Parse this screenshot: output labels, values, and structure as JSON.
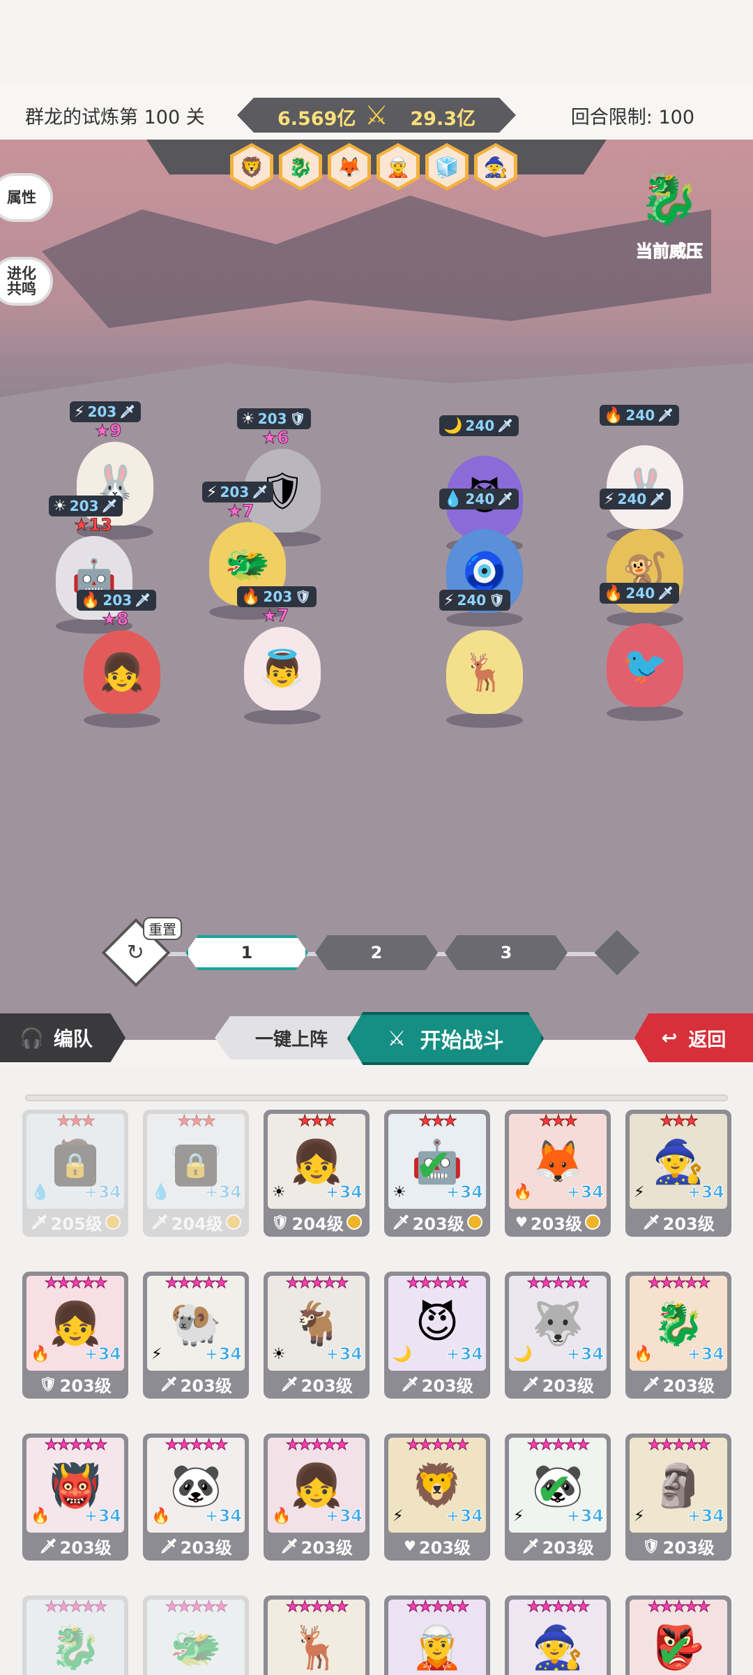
{
  "header": {
    "stage_name": "群龙的试炼第 100 关",
    "power_left": "6.569亿",
    "power_right": "29.3亿",
    "round_limit": "回合限制: 100"
  },
  "side_buttons": {
    "attributes": "属性",
    "evolution": "进化\n共鸣"
  },
  "pressure_label": "当前威压",
  "enemy_team_icons": [
    "🦁",
    "🐉",
    "🦊",
    "🧝",
    "🧊",
    "🧙"
  ],
  "player_units": [
    {
      "element": "⚡",
      "level": "203",
      "class": "🗡",
      "stars": "★9",
      "star_color": "pink",
      "avatar": "🐰"
    },
    {
      "element": "☀",
      "level": "203",
      "class": "🛡",
      "stars": "★6",
      "star_color": "pink",
      "avatar": "🛡"
    },
    {
      "element": "☀",
      "level": "203",
      "class": "🗡",
      "stars": "★13",
      "star_color": "red",
      "avatar": "🤖"
    },
    {
      "element": "⚡",
      "level": "203",
      "class": "🗡",
      "stars": "★7",
      "star_color": "pink",
      "avatar": "🐲"
    },
    {
      "element": "🔥",
      "level": "203",
      "class": "🗡",
      "stars": "★8",
      "star_color": "pink",
      "avatar": "👧"
    },
    {
      "element": "🔥",
      "level": "203",
      "class": "🛡",
      "stars": "★7",
      "star_color": "pink",
      "avatar": "👼"
    }
  ],
  "enemy_units": [
    {
      "element": "🌙",
      "level": "240",
      "class": "🗡",
      "avatar": "😈"
    },
    {
      "element": "🔥",
      "level": "240",
      "class": "🗡",
      "avatar": "🐰"
    },
    {
      "element": "💧",
      "level": "240",
      "class": "🗡",
      "avatar": "🧿"
    },
    {
      "element": "⚡",
      "level": "240",
      "class": "🗡",
      "avatar": "🐒"
    },
    {
      "element": "⚡",
      "level": "240",
      "class": "🛡",
      "avatar": "🦌"
    },
    {
      "element": "🔥",
      "level": "240",
      "class": "🗡",
      "avatar": "🐦"
    }
  ],
  "team_tabs": {
    "reset": "重置",
    "tab1": "1",
    "tab2": "2",
    "tab3": "3"
  },
  "actions": {
    "formation": "编队",
    "auto_deploy": "一键上阵",
    "start_battle": "开始战斗",
    "back": "返回"
  },
  "heroes": [
    {
      "stars": "★★★",
      "star_color": "red",
      "plus": "+34",
      "elem": "💧",
      "cls": "🗡",
      "level": "205级",
      "coin": true,
      "faded": true,
      "locked_overlay": true,
      "avatar": "🧔",
      "bar": "#b9b8bd"
    },
    {
      "stars": "★★★",
      "star_color": "red",
      "plus": "+34",
      "elem": "💧",
      "cls": "🗡",
      "level": "204级",
      "coin": true,
      "faded": true,
      "locked_overlay": true,
      "avatar": "🐻‍❄️",
      "bar": "#b9b8bd"
    },
    {
      "stars": "★★★",
      "star_color": "red",
      "plus": "+34",
      "elem": "☀",
      "cls": "🛡",
      "level": "204级",
      "coin": true,
      "avatar": "👧",
      "bar": "#8d8c92"
    },
    {
      "stars": "★★★",
      "star_color": "red",
      "plus": "+34",
      "elem": "☀",
      "cls": "🗡",
      "level": "203级",
      "coin": true,
      "checked": true,
      "avatar": "🤖",
      "bar": "#8d8c92"
    },
    {
      "stars": "★★★",
      "star_color": "red",
      "plus": "+34",
      "elem": "🔥",
      "cls": "♥",
      "level": "203级",
      "coin": true,
      "avatar": "🦊",
      "bar": "#8d8c92"
    },
    {
      "stars": "★★★",
      "star_color": "red",
      "plus": "+34",
      "elem": "⚡",
      "cls": "🗡",
      "level": "203级",
      "coin": false,
      "avatar": "🧙",
      "bar": "#8d8c92"
    },
    {
      "stars": "★★★★★",
      "star_color": "pink",
      "plus": "+34",
      "elem": "🔥",
      "cls": "🛡",
      "level": "203级",
      "avatar": "👧",
      "bar": "#8d8c92"
    },
    {
      "stars": "★★★★★",
      "star_color": "pink",
      "plus": "+34",
      "elem": "⚡",
      "cls": "🗡",
      "level": "203级",
      "avatar": "🐏",
      "bar": "#8d8c92"
    },
    {
      "stars": "★★★★★",
      "star_color": "pink",
      "plus": "+34",
      "elem": "☀",
      "cls": "🗡",
      "level": "203级",
      "avatar": "🐐",
      "bar": "#8d8c92"
    },
    {
      "stars": "★★★★★",
      "star_color": "pink",
      "plus": "+34",
      "elem": "🌙",
      "cls": "🗡",
      "level": "203级",
      "avatar": "😈",
      "bar": "#8d8c92"
    },
    {
      "stars": "★★★★★",
      "star_color": "pink",
      "plus": "+34",
      "elem": "🌙",
      "cls": "🗡",
      "level": "203级",
      "avatar": "🐺",
      "bar": "#8d8c92"
    },
    {
      "stars": "★★★★★",
      "star_color": "pink",
      "plus": "+34",
      "elem": "🔥",
      "cls": "🗡",
      "level": "203级",
      "avatar": "🐉",
      "bar": "#8d8c92"
    },
    {
      "stars": "★★★★★",
      "star_color": "pink",
      "plus": "+34",
      "elem": "🔥",
      "cls": "🗡",
      "level": "203级",
      "avatar": "👹",
      "bar": "#8d8c92"
    },
    {
      "stars": "★★★★★",
      "star_color": "pink",
      "plus": "+34",
      "elem": "🔥",
      "cls": "🗡",
      "level": "203级",
      "avatar": "🐼",
      "bar": "#8d8c92"
    },
    {
      "stars": "★★★★★",
      "star_color": "pink",
      "plus": "+34",
      "elem": "🔥",
      "cls": "🗡",
      "level": "203级",
      "avatar": "👧",
      "bar": "#8d8c92"
    },
    {
      "stars": "★★★★★",
      "star_color": "pink",
      "plus": "+34",
      "elem": "⚡",
      "cls": "♥",
      "level": "203级",
      "avatar": "🦁",
      "bar": "#8d8c92"
    },
    {
      "stars": "★★★★★",
      "star_color": "pink",
      "plus": "+34",
      "elem": "⚡",
      "cls": "🗡",
      "level": "203级",
      "checked": true,
      "avatar": "🐼",
      "bar": "#8d8c92"
    },
    {
      "stars": "★★★★★",
      "star_color": "pink",
      "plus": "+34",
      "elem": "⚡",
      "cls": "🛡",
      "level": "203级",
      "avatar": "🗿",
      "bar": "#8d8c92"
    },
    {
      "stars": "★★★★★",
      "star_color": "pink",
      "plus": "",
      "elem": "",
      "cls": "",
      "level": "",
      "faded": true,
      "avatar": "🐉",
      "bar": "#b9b8bd"
    },
    {
      "stars": "★★★★★",
      "star_color": "pink",
      "plus": "",
      "elem": "",
      "cls": "",
      "level": "",
      "faded": true,
      "avatar": "🐲",
      "bar": "#b9b8bd"
    },
    {
      "stars": "★★★★★",
      "star_color": "pink",
      "plus": "",
      "elem": "",
      "cls": "",
      "level": "",
      "avatar": "🦌",
      "bar": "#8d8c92"
    },
    {
      "stars": "★★★★★",
      "star_color": "pink",
      "plus": "",
      "elem": "",
      "cls": "",
      "level": "",
      "avatar": "🧝",
      "bar": "#8d8c92"
    },
    {
      "stars": "★★★★★",
      "star_color": "pink",
      "plus": "",
      "elem": "",
      "cls": "",
      "level": "",
      "avatar": "🧙",
      "bar": "#8d8c92"
    },
    {
      "stars": "★★★★★",
      "star_color": "pink",
      "plus": "",
      "elem": "",
      "cls": "",
      "level": "",
      "checked": true,
      "avatar": "👺",
      "bar": "#8d8c92"
    }
  ],
  "colors": {
    "accent_teal": "#158e83",
    "back_red": "#d7303a",
    "gold": "#ffe07a"
  }
}
